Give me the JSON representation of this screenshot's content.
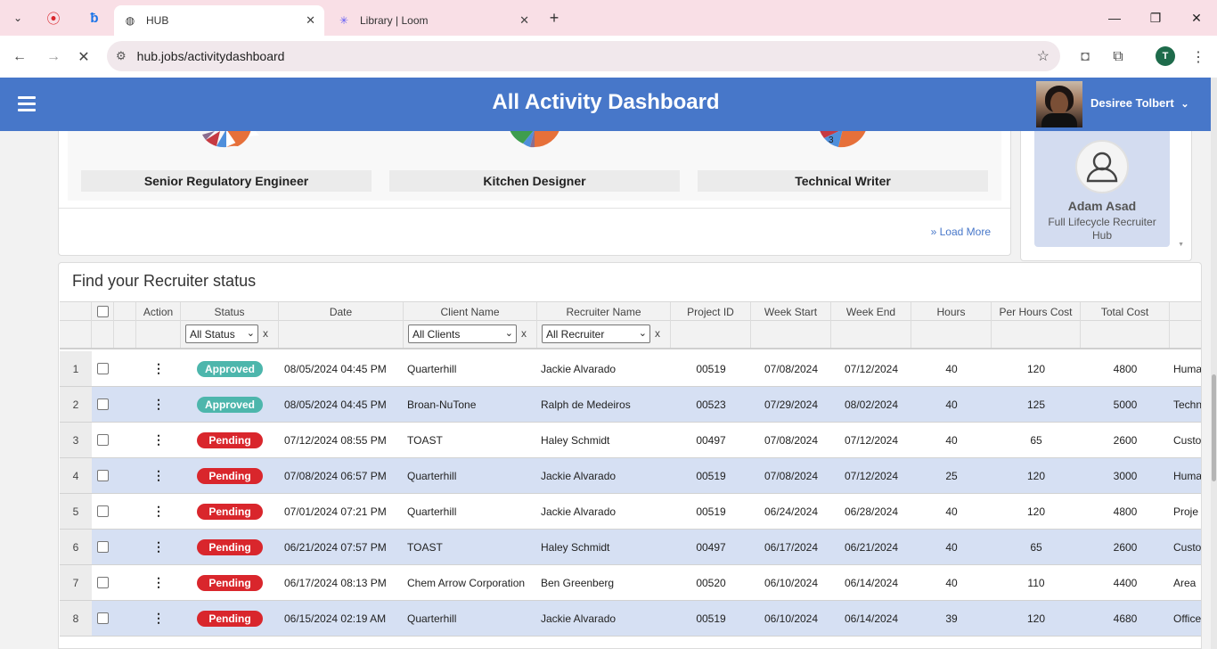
{
  "browser": {
    "tabs": [
      {
        "title": "HUB",
        "active": true
      },
      {
        "title": "Library | Loom",
        "active": false
      }
    ],
    "url": "hub.jobs/activitydashboard",
    "profile_initial": "T"
  },
  "app": {
    "title": "All Activity Dashboard",
    "user_name": "Desiree Tolbert",
    "accent_color": "#4777c9"
  },
  "job_cards": [
    {
      "title": "Senior Regulatory Engineer"
    },
    {
      "title": "Kitchen Designer"
    },
    {
      "title": "Technical Writer",
      "slice_label": "3"
    }
  ],
  "load_more_label": "Load More",
  "recruiter_card": {
    "name": "Adam Asad",
    "role": "Full Lifecycle Recruiter Hub"
  },
  "table": {
    "title": "Find your Recruiter status",
    "headers": {
      "action": "Action",
      "status": "Status",
      "date": "Date",
      "client": "Client Name",
      "recruiter": "Recruiter Name",
      "project": "Project ID",
      "week_start": "Week Start",
      "week_end": "Week End",
      "hours": "Hours",
      "rate": "Per Hours Cost",
      "total": "Total Cost"
    },
    "filters": {
      "status": "All Status",
      "client": "All Clients",
      "recruiter": "All Recruiter",
      "clear": "x"
    },
    "rows": [
      {
        "n": "1",
        "status": "Approved",
        "date": "08/05/2024 04:45 PM",
        "client": "Quarterhill",
        "recruiter": "Jackie Alvarado",
        "project": "00519",
        "week_start": "07/08/2024",
        "week_end": "07/12/2024",
        "hours": "40",
        "rate": "120",
        "total": "4800",
        "extra": "Huma"
      },
      {
        "n": "2",
        "status": "Approved",
        "date": "08/05/2024 04:45 PM",
        "client": "Broan-NuTone",
        "recruiter": "Ralph de Medeiros",
        "project": "00523",
        "week_start": "07/29/2024",
        "week_end": "08/02/2024",
        "hours": "40",
        "rate": "125",
        "total": "5000",
        "extra": "Techn"
      },
      {
        "n": "3",
        "status": "Pending",
        "date": "07/12/2024 08:55 PM",
        "client": "TOAST",
        "recruiter": "Haley Schmidt",
        "project": "00497",
        "week_start": "07/08/2024",
        "week_end": "07/12/2024",
        "hours": "40",
        "rate": "65",
        "total": "2600",
        "extra": "Custo"
      },
      {
        "n": "4",
        "status": "Pending",
        "date": "07/08/2024 06:57 PM",
        "client": "Quarterhill",
        "recruiter": "Jackie Alvarado",
        "project": "00519",
        "week_start": "07/08/2024",
        "week_end": "07/12/2024",
        "hours": "25",
        "rate": "120",
        "total": "3000",
        "extra": "Huma"
      },
      {
        "n": "5",
        "status": "Pending",
        "date": "07/01/2024 07:21 PM",
        "client": "Quarterhill",
        "recruiter": "Jackie Alvarado",
        "project": "00519",
        "week_start": "06/24/2024",
        "week_end": "06/28/2024",
        "hours": "40",
        "rate": "120",
        "total": "4800",
        "extra": "Proje"
      },
      {
        "n": "6",
        "status": "Pending",
        "date": "06/21/2024 07:57 PM",
        "client": "TOAST",
        "recruiter": "Haley Schmidt",
        "project": "00497",
        "week_start": "06/17/2024",
        "week_end": "06/21/2024",
        "hours": "40",
        "rate": "65",
        "total": "2600",
        "extra": "Custo"
      },
      {
        "n": "7",
        "status": "Pending",
        "date": "06/17/2024 08:13 PM",
        "client": "Chem Arrow Corporation",
        "recruiter": "Ben Greenberg",
        "project": "00520",
        "week_start": "06/10/2024",
        "week_end": "06/14/2024",
        "hours": "40",
        "rate": "110",
        "total": "4400",
        "extra": "Area"
      },
      {
        "n": "8",
        "status": "Pending",
        "date": "06/15/2024 02:19 AM",
        "client": "Quarterhill",
        "recruiter": "Jackie Alvarado",
        "project": "00519",
        "week_start": "06/10/2024",
        "week_end": "06/14/2024",
        "hours": "39",
        "rate": "120",
        "total": "4680",
        "extra": "Office"
      }
    ]
  },
  "colors": {
    "approved": "#4db6ac",
    "pending": "#d9262c",
    "row_alt": "#d6e0f3"
  }
}
